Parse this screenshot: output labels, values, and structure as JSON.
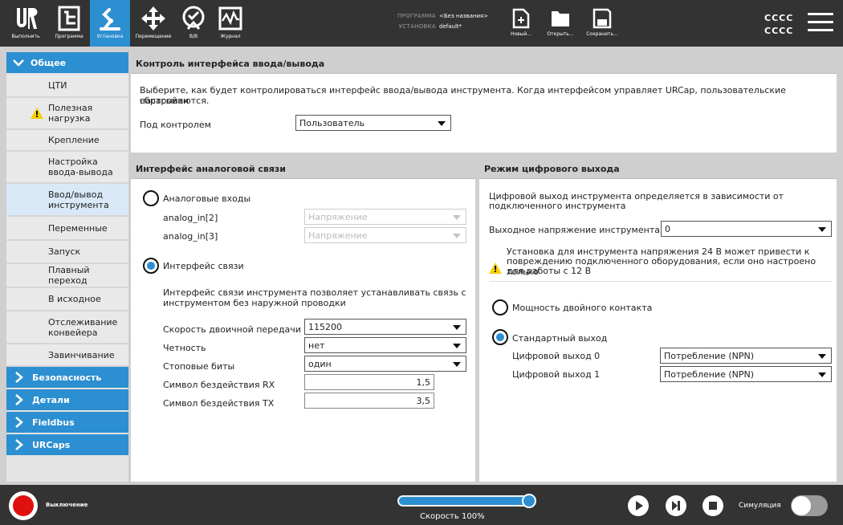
{
  "topbar": {
    "nav": [
      {
        "label": "Выполнить",
        "icon": "ur-logo-icon"
      },
      {
        "label": "Программа",
        "icon": "program-icon"
      },
      {
        "label": "Установка",
        "icon": "installation-icon",
        "active": true
      },
      {
        "label": "Перемещение",
        "icon": "move-icon"
      },
      {
        "label": "В/В",
        "icon": "io-icon"
      },
      {
        "label": "Журнал",
        "icon": "log-icon"
      }
    ],
    "program_label": "ПРОГРАММА",
    "program_value": "<Без названия>",
    "installation_label": "УСТАНОВКА",
    "installation_value": "default*",
    "file": {
      "new": "Новый...",
      "open": "Открыть...",
      "save": "Сохранить..."
    },
    "user_line1": "CCCC",
    "user_line2": "CCCC"
  },
  "sidebar": {
    "general": "Общее",
    "items": [
      {
        "label": "ЦТИ",
        "lines": [
          "ЦТИ"
        ]
      },
      {
        "label": "Полезная нагрузка",
        "lines": [
          "Полезная",
          "нагрузка"
        ],
        "warning": true
      },
      {
        "label": "Крепление",
        "lines": [
          "Крепление"
        ]
      },
      {
        "label": "Настройка ввода-вывода",
        "lines": [
          "Настройка",
          "ввода-вывода"
        ]
      },
      {
        "label": "Ввод/вывод инструмента",
        "lines": [
          "Ввод/вывод",
          "инструмента"
        ],
        "selected": true
      },
      {
        "label": "Переменные",
        "lines": [
          "Переменные"
        ]
      },
      {
        "label": "Запуск",
        "lines": [
          "Запуск"
        ]
      },
      {
        "label": "Плавный переход",
        "lines": [
          "Плавный переход"
        ]
      },
      {
        "label": "В исходное",
        "lines": [
          "В исходное"
        ]
      },
      {
        "label": "Отслеживание конвейера",
        "lines": [
          "Отслеживание",
          "конвейера"
        ]
      },
      {
        "label": "Завинчивание",
        "lines": [
          "Завинчивание"
        ]
      }
    ],
    "categories": [
      "Безопасность",
      "Детали",
      "Fieldbus",
      "URCaps"
    ]
  },
  "control_panel": {
    "title": "Контроль интерфейса ввода/вывода",
    "description_line1": "Выберите, как будет контролироваться интерфейс ввода/вывода инструмента. Когда интерфейсом управляет URCap, пользовательские настройки",
    "description_line2": "сбрасываются.",
    "controlled_by_label": "Под контролем",
    "controlled_by_value": "Пользователь"
  },
  "analog_panel": {
    "title": "Интерфейс аналоговой связи",
    "analog_inputs_label": "Аналоговые входы",
    "analog_in2_label": "analog_in[2]",
    "analog_in2_value": "Напряжение",
    "analog_in3_label": "analog_in[3]",
    "analog_in3_value": "Напряжение",
    "comm_interface_label": "Интерфейс связи",
    "comm_desc_line1": "Интерфейс связи инструмента позволяет устанавливать связь с",
    "comm_desc_line2": "инструментом без наружной проводки",
    "baud_label": "Скорость двоичной передачи",
    "baud_value": "115200",
    "parity_label": "Четность",
    "parity_value": "нет",
    "stopbits_label": "Стоповые биты",
    "stopbits_value": "один",
    "rx_idle_label": "Символ бездействия RX",
    "rx_idle_value": "1,5",
    "tx_idle_label": "Символ бездействия TX",
    "tx_idle_value": "3,5"
  },
  "digital_panel": {
    "title": "Режим цифрового выхода",
    "desc_line1": "Цифровой выход инструмента определяется в зависимости от",
    "desc_line2": "подключенного инструмента",
    "voltage_label": "Выходное напряжение инструмента",
    "voltage_value": "0",
    "warning_line1": "Установка для инструмента напряжения 24 В может привести к",
    "warning_line2": "повреждению подключенного оборудования, если оно настроено только",
    "warning_line3": "для работы с 12 В",
    "dual_pin_label": "Мощность двойного контакта",
    "standard_label": "Стандартный выход",
    "dout0_label": "Цифровой выход 0",
    "dout0_value": "Потребление (NPN)",
    "dout1_label": "Цифровой выход 1",
    "dout1_value": "Потребление (NPN)"
  },
  "bottombar": {
    "power_label": "Выключение",
    "speed_label": "Скорость 100%",
    "speed_percent": 100,
    "simulation_label": "Симуляция"
  },
  "colors": {
    "accent": "#2c8fd1",
    "bar": "#333333",
    "panel_header": "#cfcfcf",
    "warning": "#f5d000",
    "power": "#e01010"
  }
}
